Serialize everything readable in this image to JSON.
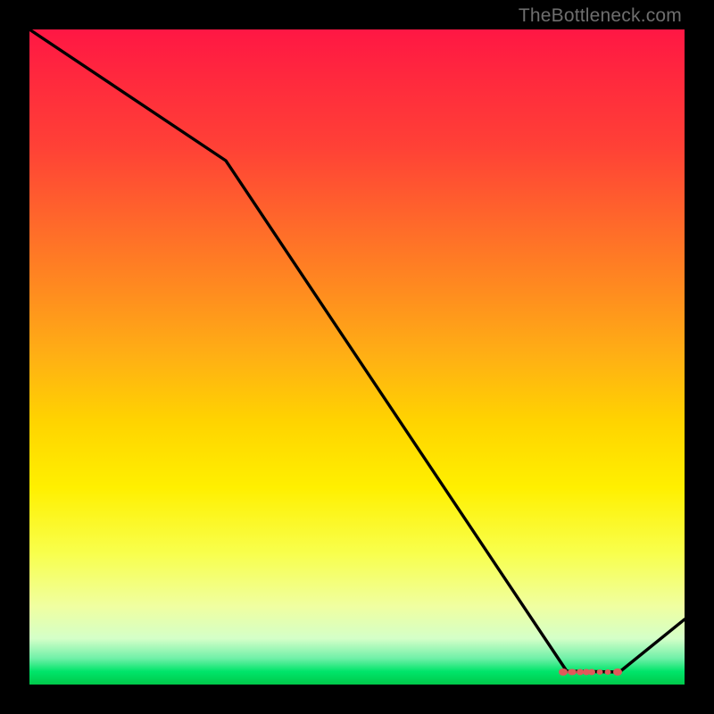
{
  "attribution": "TheBottleneck.com",
  "colors": {
    "background": "#000000",
    "line": "#000000",
    "marker": "#e05a5a",
    "gradient_top": "#ff1744",
    "gradient_bottom": "#00c84a"
  },
  "chart_data": {
    "type": "line",
    "title": "",
    "xlabel": "",
    "ylabel": "",
    "xlim": [
      0,
      100
    ],
    "ylim": [
      0,
      100
    ],
    "x": [
      0,
      30,
      82,
      90,
      100
    ],
    "values": [
      100,
      80,
      2,
      2,
      10
    ],
    "markers": {
      "x_start": 81,
      "x_end": 90,
      "y": 2,
      "note": "flat valley segment with small red markers"
    },
    "annotations": []
  }
}
